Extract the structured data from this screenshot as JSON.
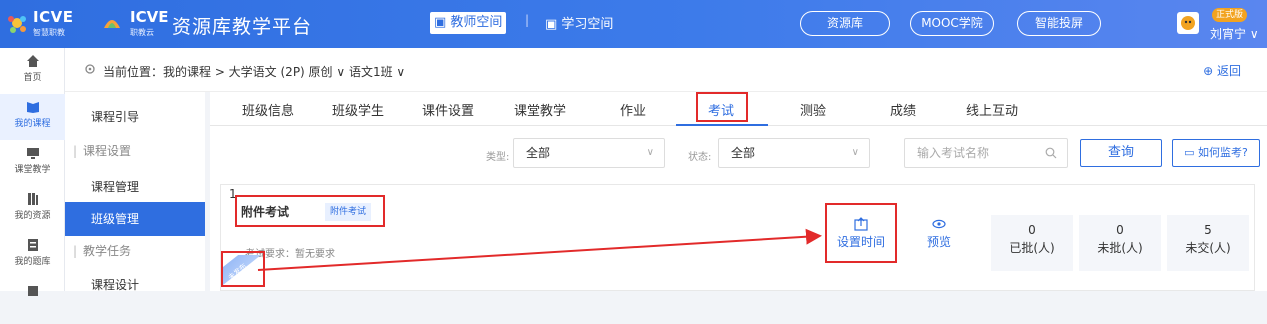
{
  "header": {
    "brand1": "ICVE",
    "brand1_sub": "智慧职教",
    "brand2": "ICVE",
    "brand2_sub": "职教云",
    "app_title": "资源库教学平台",
    "teacher_space": "教师空间",
    "student_space": "学习空间",
    "pills": [
      "资源库",
      "MOOC学院",
      "智能投屏"
    ],
    "edition": "正式版",
    "username": "刘宵宁"
  },
  "leftnav": [
    {
      "label": "首页",
      "icon": "home-icon"
    },
    {
      "label": "我的课程",
      "icon": "book-icon",
      "active": true
    },
    {
      "label": "课堂教学",
      "icon": "screen-icon"
    },
    {
      "label": "我的资源",
      "icon": "library-icon"
    },
    {
      "label": "我的题库",
      "icon": "question-bank-icon"
    },
    {
      "label": "",
      "icon": "more-icon"
    }
  ],
  "breadcrumb": {
    "text": "当前位置：我的课程 > 大学语文 (2P) 原创 ∨ 语文1班 ∨",
    "back": "返回"
  },
  "subnav": [
    {
      "label": "课程引导",
      "type": "item"
    },
    {
      "label": "课程设置",
      "type": "group"
    },
    {
      "label": "课程管理",
      "type": "item"
    },
    {
      "label": "班级管理",
      "type": "item",
      "active": true
    },
    {
      "label": "教学任务",
      "type": "group"
    },
    {
      "label": "课程设计",
      "type": "item"
    }
  ],
  "tabs": [
    "班级信息",
    "班级学生",
    "课件设置",
    "课堂教学",
    "作业",
    "考试",
    "测验",
    "成绩",
    "线上互动"
  ],
  "filters": {
    "type_label": "类型:",
    "type_value": "全部",
    "status_label": "状态:",
    "status_value": "全部",
    "search_placeholder": "输入考试名称",
    "query_btn": "查询",
    "how_btn": "如何监考?"
  },
  "card": {
    "index": "1",
    "title": "附件考试",
    "tag": "附件考试",
    "requirement": "考试要求：暂无要求",
    "ribbon": "未发布",
    "actions": [
      "设置时间",
      "预览"
    ],
    "stats": [
      {
        "value": "0",
        "label": "已批(人)"
      },
      {
        "value": "0",
        "label": "未批(人)"
      },
      {
        "value": "5",
        "label": "未交(人)"
      }
    ]
  },
  "colors": {
    "primary": "#2f6ee0",
    "annotation": "#e22a2a"
  }
}
